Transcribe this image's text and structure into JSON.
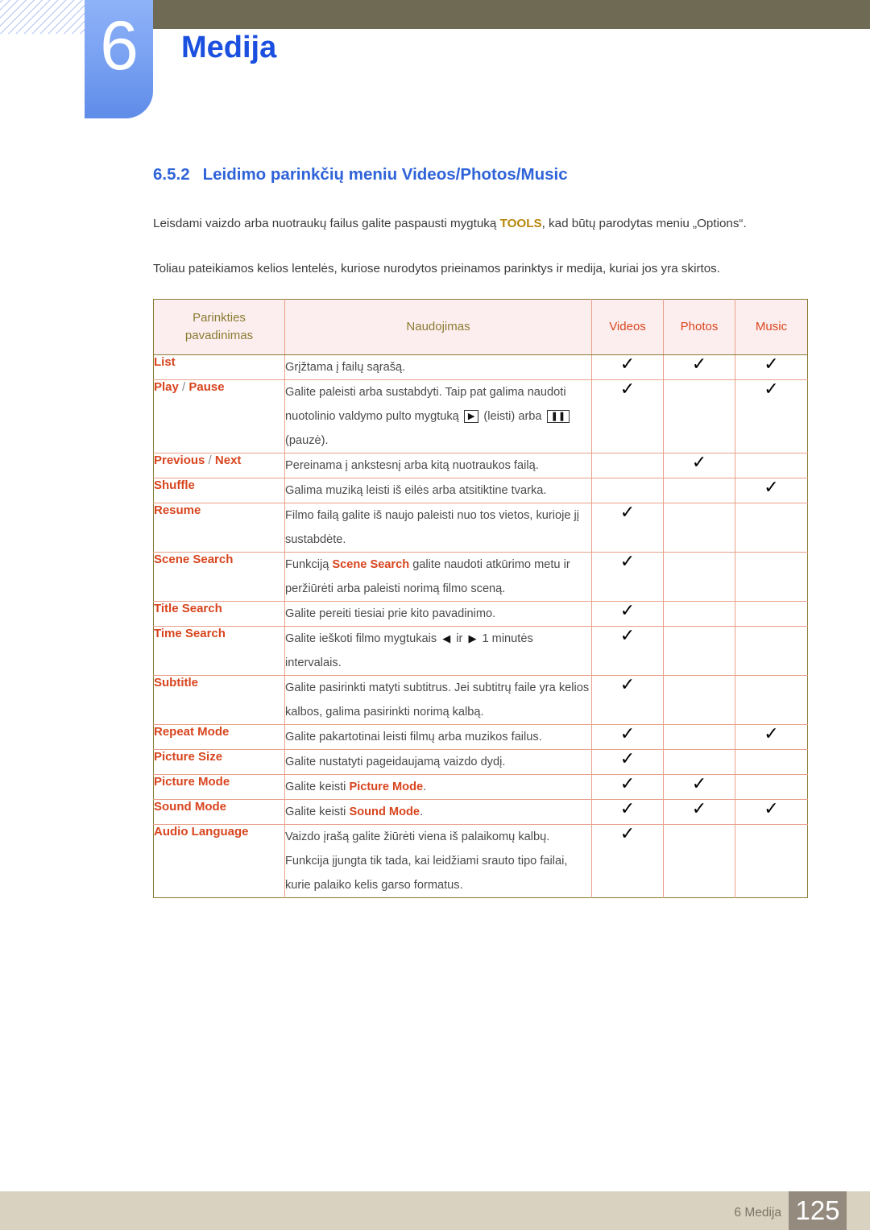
{
  "header": {
    "chapter_number": "6",
    "chapter_title": "Medija"
  },
  "section": {
    "number": "6.5.2",
    "title": "Leidimo parinkčių meniu Videos/Photos/Music"
  },
  "body": {
    "para1_before": "Leisdami vaizdo arba nuotraukų failus galite paspausti mygtuką ",
    "para1_tools": "TOOLS",
    "para1_after": ", kad būtų parodytas meniu „Options“.",
    "para2": "Toliau pateikiamos kelios lentelės, kuriose nurodytos prieinamos parinktys ir medija, kuriai jos yra skirtos."
  },
  "table": {
    "headers": {
      "name": "Parinkties pavadinimas",
      "usage": "Naudojimas",
      "videos": "Videos",
      "photos": "Photos",
      "music": "Music"
    },
    "check_glyph": "✓",
    "rows": [
      {
        "name": "List",
        "name_parts": [
          {
            "text": "List",
            "style": "label"
          }
        ],
        "usage_parts": [
          {
            "text": "Grįžtama į failų sąrašą.",
            "style": "plain"
          }
        ],
        "videos": true,
        "photos": true,
        "music": true
      },
      {
        "name": "Play / Pause",
        "name_parts": [
          {
            "text": "Play",
            "style": "label"
          },
          {
            "text": " / ",
            "style": "sep"
          },
          {
            "text": "Pause",
            "style": "label"
          }
        ],
        "usage_parts": [
          {
            "text": "Galite paleisti arba sustabdyti. Taip pat galima naudoti nuotolinio valdymo pulto mygtuką ",
            "style": "plain"
          },
          {
            "text": "▶",
            "style": "keybox"
          },
          {
            "text": " (leisti) arba ",
            "style": "plain"
          },
          {
            "text": "❚❚",
            "style": "keybox"
          },
          {
            "text": " (pauzė).",
            "style": "plain"
          }
        ],
        "videos": true,
        "photos": false,
        "music": true
      },
      {
        "name": "Previous / Next",
        "name_parts": [
          {
            "text": "Previous",
            "style": "label"
          },
          {
            "text": " / ",
            "style": "sep"
          },
          {
            "text": "Next",
            "style": "label"
          }
        ],
        "usage_parts": [
          {
            "text": "Pereinama į ankstesnį arba kitą nuotraukos failą.",
            "style": "plain"
          }
        ],
        "videos": false,
        "photos": true,
        "music": false
      },
      {
        "name": "Shuffle",
        "name_parts": [
          {
            "text": "Shuffle",
            "style": "label"
          }
        ],
        "usage_parts": [
          {
            "text": "Galima muziką leisti iš eilės arba atsitiktine tvarka.",
            "style": "plain"
          }
        ],
        "videos": false,
        "photos": false,
        "music": true
      },
      {
        "name": "Resume",
        "name_parts": [
          {
            "text": "Resume",
            "style": "label"
          }
        ],
        "usage_parts": [
          {
            "text": "Filmo failą galite iš naujo paleisti nuo tos vietos, kurioje jį sustabdėte.",
            "style": "plain"
          }
        ],
        "videos": true,
        "photos": false,
        "music": false
      },
      {
        "name": "Scene Search",
        "name_parts": [
          {
            "text": "Scene Search",
            "style": "label"
          }
        ],
        "usage_parts": [
          {
            "text": "Funkciją ",
            "style": "plain"
          },
          {
            "text": "Scene Search",
            "style": "hl"
          },
          {
            "text": " galite naudoti atkūrimo metu ir peržiūrėti arba paleisti norimą filmo sceną.",
            "style": "plain"
          }
        ],
        "videos": true,
        "photos": false,
        "music": false
      },
      {
        "name": "Title Search",
        "name_parts": [
          {
            "text": "Title Search",
            "style": "label"
          }
        ],
        "usage_parts": [
          {
            "text": "Galite pereiti tiesiai prie kito pavadinimo.",
            "style": "plain"
          }
        ],
        "videos": true,
        "photos": false,
        "music": false
      },
      {
        "name": "Time Search",
        "name_parts": [
          {
            "text": "Time Search",
            "style": "label"
          }
        ],
        "usage_parts": [
          {
            "text": "Galite ieškoti filmo mygtukais ",
            "style": "plain"
          },
          {
            "text": "◀",
            "style": "tri"
          },
          {
            "text": " ir ",
            "style": "plain"
          },
          {
            "text": "▶",
            "style": "tri"
          },
          {
            "text": " 1 minutės intervalais.",
            "style": "plain"
          }
        ],
        "videos": true,
        "photos": false,
        "music": false
      },
      {
        "name": "Subtitle",
        "name_parts": [
          {
            "text": "Subtitle",
            "style": "label"
          }
        ],
        "usage_parts": [
          {
            "text": "Galite pasirinkti matyti subtitrus. Jei subtitrų faile yra kelios kalbos, galima pasirinkti norimą kalbą.",
            "style": "plain"
          }
        ],
        "videos": true,
        "photos": false,
        "music": false
      },
      {
        "name": "Repeat Mode",
        "name_parts": [
          {
            "text": "Repeat Mode",
            "style": "label"
          }
        ],
        "usage_parts": [
          {
            "text": "Galite pakartotinai leisti filmų arba muzikos failus.",
            "style": "plain"
          }
        ],
        "videos": true,
        "photos": false,
        "music": true
      },
      {
        "name": "Picture Size",
        "name_parts": [
          {
            "text": "Picture Size",
            "style": "label"
          }
        ],
        "usage_parts": [
          {
            "text": "Galite nustatyti pageidaujamą vaizdo dydį.",
            "style": "plain"
          }
        ],
        "videos": true,
        "photos": false,
        "music": false
      },
      {
        "name": "Picture Mode",
        "name_parts": [
          {
            "text": "Picture Mode",
            "style": "label"
          }
        ],
        "usage_parts": [
          {
            "text": "Galite keisti ",
            "style": "plain"
          },
          {
            "text": "Picture Mode",
            "style": "hl"
          },
          {
            "text": ".",
            "style": "plain"
          }
        ],
        "videos": true,
        "photos": true,
        "music": false
      },
      {
        "name": "Sound Mode",
        "name_parts": [
          {
            "text": "Sound Mode",
            "style": "label"
          }
        ],
        "usage_parts": [
          {
            "text": "Galite keisti ",
            "style": "plain"
          },
          {
            "text": "Sound Mode",
            "style": "hl"
          },
          {
            "text": ".",
            "style": "plain"
          }
        ],
        "videos": true,
        "photos": true,
        "music": true
      },
      {
        "name": "Audio Language",
        "name_parts": [
          {
            "text": "Audio Language",
            "style": "label"
          }
        ],
        "usage_parts": [
          {
            "text": "Vaizdo įrašą galite žiūrėti viena iš palaikomų kalbų. Funkcija įjungta tik tada, kai leidžiami srauto tipo failai, kurie palaiko kelis garso formatus.",
            "style": "plain"
          }
        ],
        "videos": true,
        "photos": false,
        "music": false
      }
    ]
  },
  "footer": {
    "label": "6 Medija",
    "page": "125"
  },
  "colors": {
    "chapter_title": "#1a4fe0",
    "section_heading": "#2f63d8",
    "tools_highlight": "#b8860b",
    "table_label": "#d8451e",
    "table_header_olive": "#8a7b33",
    "table_border_outer": "#8a7b33",
    "table_border_inner": "#e8a08a",
    "table_header_bg": "#fceeee",
    "olive_bar": "#6e6a54",
    "footer_bar": "#d9d2c0",
    "footer_page_bg": "#948a7e"
  }
}
